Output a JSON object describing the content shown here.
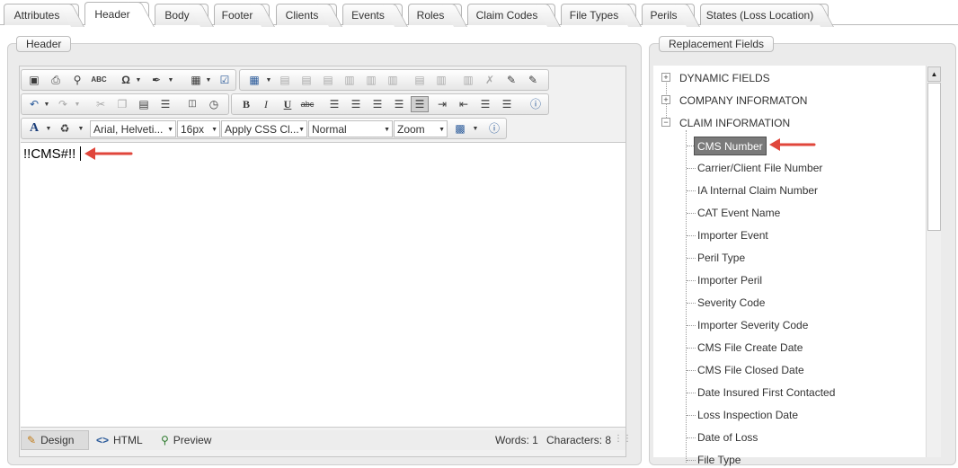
{
  "tabs": [
    {
      "label": "Attributes",
      "active": false
    },
    {
      "label": "Header",
      "active": true
    },
    {
      "label": "Body",
      "active": false
    },
    {
      "label": "Footer",
      "active": false
    },
    {
      "label": "Clients",
      "active": false
    },
    {
      "label": "Events",
      "active": false
    },
    {
      "label": "Roles",
      "active": false
    },
    {
      "label": "Claim Codes",
      "active": false
    },
    {
      "label": "File Types",
      "active": false
    },
    {
      "label": "Perils",
      "active": false
    },
    {
      "label": "States (Loss Location)",
      "active": false
    }
  ],
  "header_panel": {
    "legend": "Header"
  },
  "editor": {
    "font_dropdown": "Arial, Helveti...",
    "size_dropdown": "16px",
    "css_dropdown": "Apply CSS Cl...",
    "paragraph_dropdown": "Normal",
    "zoom_dropdown": "Zoom",
    "content": "!!CMS#!!",
    "modes": {
      "design": "Design",
      "html": "HTML",
      "preview": "Preview"
    },
    "words": "Words: 1",
    "characters": "Characters: 8"
  },
  "replacement_panel": {
    "legend": "Replacement Fields",
    "groups": [
      {
        "label": "DYNAMIC FIELDS",
        "expanded": false
      },
      {
        "label": "COMPANY INFORMATON",
        "expanded": false
      },
      {
        "label": "CLAIM INFORMATION",
        "expanded": true
      }
    ],
    "claim_items": [
      {
        "label": "CMS Number",
        "selected": true
      },
      {
        "label": "Carrier/Client File Number"
      },
      {
        "label": "IA Internal Claim Number"
      },
      {
        "label": "CAT Event Name"
      },
      {
        "label": "Importer Event"
      },
      {
        "label": "Peril Type"
      },
      {
        "label": "Importer Peril"
      },
      {
        "label": "Severity Code"
      },
      {
        "label": "Importer Severity Code"
      },
      {
        "label": "CMS File Create Date"
      },
      {
        "label": "CMS File Closed Date"
      },
      {
        "label": "Date Insured First Contacted"
      },
      {
        "label": "Loss Inspection Date"
      },
      {
        "label": "Date of Loss"
      },
      {
        "label": "File Type"
      }
    ]
  },
  "colors": {
    "annotation_arrow": "#e0463b",
    "selected_node": "#7a7a7a"
  }
}
